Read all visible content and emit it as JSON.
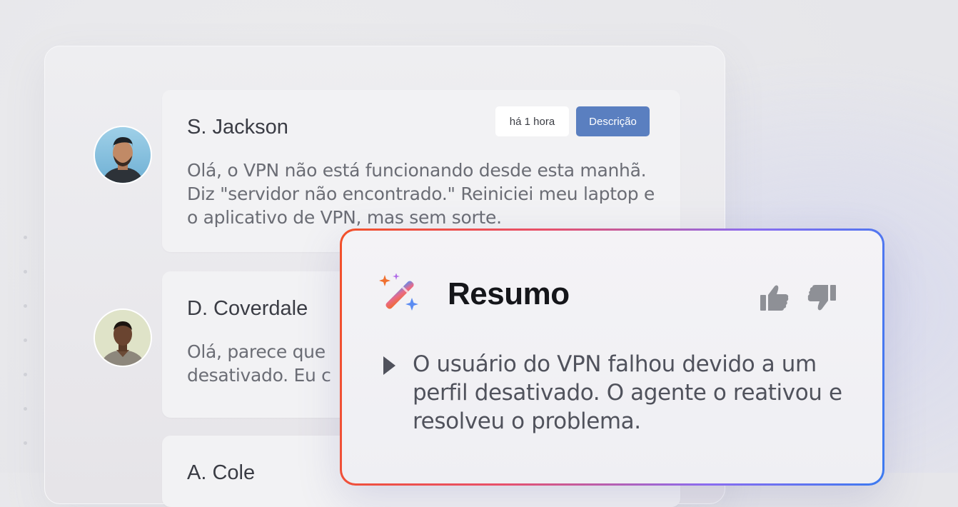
{
  "tickets": [
    {
      "name": "S. Jackson",
      "time": "há 1 hora",
      "action_label": "Descrição",
      "message": "Olá, o VPN não está funcionando desde esta manhã. Diz \"servidor não encontrado.\" Reiniciei meu laptop e o aplicativo de VPN, mas sem sorte."
    },
    {
      "name": "D. Coverdale",
      "message": "Olá, parece que\ndesativado. Eu c"
    },
    {
      "name": "A. Cole"
    }
  ],
  "summary": {
    "icon": "magic-wand-sparkles-icon",
    "title": "Resumo",
    "text": "O usuário do VPN falhou devido a um perfil desativado. O agente o reativou e resolveu o problema.",
    "feedback_icons": [
      "thumbs-up-icon",
      "thumbs-down-icon"
    ]
  },
  "colors": {
    "accent": "#5a7fc0",
    "gradient_start": "#f2502a",
    "gradient_end": "#3c7af0"
  }
}
